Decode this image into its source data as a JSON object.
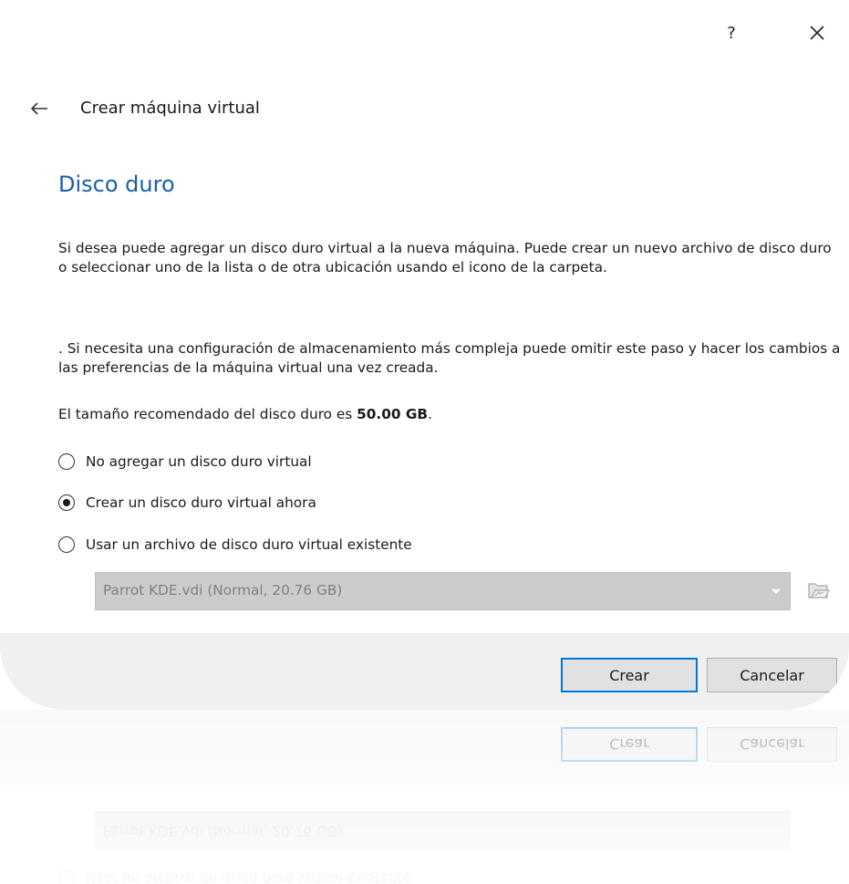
{
  "window": {
    "help_label": "?"
  },
  "wizard": {
    "title": "Crear máquina virtual"
  },
  "page": {
    "section_title": "Disco duro",
    "paragraph1": "Si desea puede agregar un disco duro virtual a la nueva máquina. Puede crear un nuevo archivo de disco duro o seleccionar uno de la lista o de otra ubicación usando el icono de la carpeta.",
    "paragraph2": ". Si necesita una configuración de almacenamiento más compleja puede omitir este paso y hacer los cambios a las preferencias de la máquina virtual una vez creada.",
    "recommended_prefix": "El tamaño recomendado del disco duro es ",
    "recommended_size": "50.00 GB",
    "recommended_suffix": "."
  },
  "options": [
    {
      "label": "No agregar un disco duro virtual",
      "checked": false
    },
    {
      "label": "Crear un disco duro virtual ahora",
      "checked": true
    },
    {
      "label": "Usar un archivo de disco duro virtual existente",
      "checked": false
    }
  ],
  "disk_select": {
    "value": "Parrot KDE.vdi (Normal, 20.76 GB)",
    "disabled": true
  },
  "footer": {
    "create_label": "Crear",
    "cancel_label": "Cancelar"
  },
  "colors": {
    "accent": "#0078d7",
    "section_title": "#1a5ea8",
    "footer_bg": "#f0f0f0",
    "disabled_combo": "#cccccc"
  },
  "icons": {
    "help": "question-mark-icon",
    "close": "close-icon",
    "back": "back-arrow-icon",
    "combo": "chevron-down-icon",
    "folder": "folder-icon"
  }
}
